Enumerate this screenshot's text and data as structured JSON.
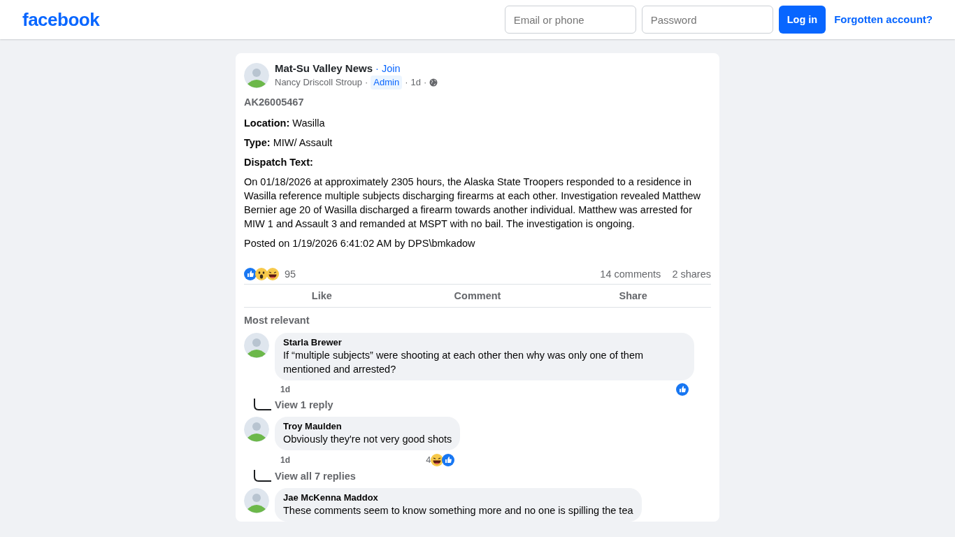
{
  "header": {
    "logo": "facebook",
    "email": {
      "placeholder": "Email or phone"
    },
    "password": {
      "placeholder": "Password"
    },
    "login": "Log in",
    "forgot": "Forgotten account?"
  },
  "post": {
    "group": "Mat-Su Valley News",
    "separator": "·",
    "join": "Join",
    "author": "Nancy Driscoll Stroup",
    "separator_2": "·",
    "badge": "Admin",
    "separator_3": "·",
    "time": "1d",
    "separator_4": "·",
    "paragraphs": [
      {
        "kind": "title",
        "text": "AK26005467"
      },
      {
        "kind": "field",
        "label": "Location:",
        "text": "Wasilla"
      },
      {
        "kind": "field",
        "label": "Type:",
        "text": "MIW/ Assault"
      },
      {
        "kind": "field",
        "label": "Dispatch Text:"
      },
      {
        "kind": "body",
        "text": "On 01/18/2026 at approximately 2305 hours, the Alaska State Troopers responded to a residence in Wasilla reference multiple subjects discharging firearms at each other. Investigation revealed Matthew Bernier age 20 of Wasilla discharged a firearm towards another individual. Matthew was arrested for MIW 1 and Assault 3 and remanded at MSPT with no bail. The investigation is ongoing."
      },
      {
        "kind": "body",
        "text": "Posted on 1/19/2026 6:41:02 AM by DPS\\bmkadow"
      }
    ],
    "reactions": [
      {
        "kind": "like"
      },
      {
        "kind": "wow"
      },
      {
        "kind": "haha"
      }
    ],
    "reaction_count": "95",
    "comments_count": "14 comments",
    "shares_count": "2 shares",
    "actions": [
      "Like",
      "Comment",
      "Share"
    ],
    "sort": "Most relevant"
  },
  "comments": [
    {
      "author": "Starla Brewer",
      "text": "If “multiple subjects” were shooting at each other then why was only one of them mentioned and arrested?",
      "time": "1d",
      "reactions": [
        {
          "kind": "like"
        }
      ],
      "replies": "View 1 reply"
    },
    {
      "author": "Troy Maulden",
      "text": "Obviously they're not very good shots",
      "time": "1d",
      "reaction_count": "4",
      "reactions": [
        {
          "kind": "haha"
        },
        {
          "kind": "like"
        }
      ],
      "replies": "View all 7 replies"
    },
    {
      "author": "Jae McKenna Maddox",
      "text": "These comments seem to know something more and no one is spilling the tea"
    }
  ]
}
